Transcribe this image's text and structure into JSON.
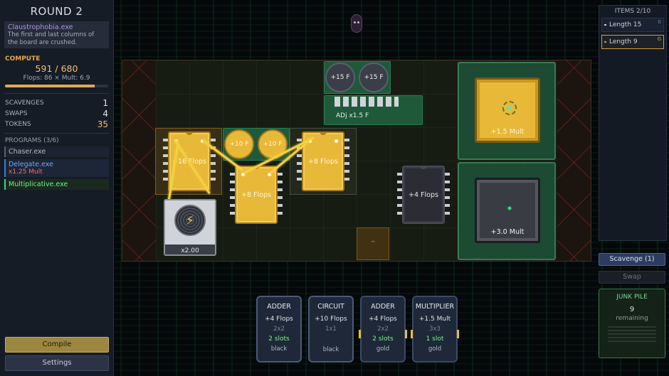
{
  "sidebar": {
    "round_title": "ROUND 2",
    "modifier": {
      "name": "Claustrophobia.exe",
      "description": "The first and last columns of the board are crushed."
    },
    "compute": {
      "label": "COMPUTE",
      "value": "591 / 680",
      "detail": "Flops: 86  ×  Mult: 6.9",
      "progress_fraction": 0.869
    },
    "stats": [
      {
        "label": "SCAVENGES",
        "value": "1"
      },
      {
        "label": "SWAPS",
        "value": "4"
      },
      {
        "label": "TOKENS",
        "value": "35"
      }
    ],
    "programs_header": "PROGRAMS (3/6)",
    "programs": [
      {
        "name": "Chaser.exe",
        "effect": ""
      },
      {
        "name": "Delegate.exe",
        "effect": "x1.25 Mult"
      },
      {
        "name": "Multiplicative.exe",
        "effect": ""
      }
    ],
    "compile_label": "Compile",
    "settings_label": "Settings"
  },
  "items_panel": {
    "header": "ITEMS 2/10",
    "items": [
      {
        "label": "Length 15",
        "key": "B"
      },
      {
        "label": "Length 9",
        "key": "G"
      }
    ],
    "scavenge_label": "Scavenge (1)",
    "swap_label": "Swap",
    "junk": {
      "title": "JUNK PILE",
      "count": "9",
      "sub": "remaining"
    }
  },
  "board": {
    "chips": [
      {
        "label": "+16 Flops",
        "color": "gold"
      },
      {
        "label": "+8 Flops",
        "color": "gold"
      },
      {
        "label": "+8 Flops",
        "color": "gold"
      },
      {
        "label": "+4 Flops",
        "color": "black"
      }
    ],
    "caps": [
      {
        "label": "+10 F"
      },
      {
        "label": "+10 F"
      },
      {
        "label": "+15 F"
      },
      {
        "label": "+15 F"
      }
    ],
    "adj_label": "ADj x1.5 F",
    "psu_label": "x2.00",
    "cpus": [
      {
        "label": "+1.5 Mult",
        "color": "gold"
      },
      {
        "label": "+3.0 Mult",
        "color": "dark"
      }
    ],
    "empty_slot_marker": "^"
  },
  "hand": [
    {
      "title": "ADDER",
      "effect": "+4 Flops",
      "size": "2x2",
      "slots": "2 slots",
      "type": "black"
    },
    {
      "title": "CIRCUIT",
      "effect": "+10 Flops",
      "size": "1x1",
      "slots": "",
      "type": "black"
    },
    {
      "title": "ADDER",
      "effect": "+4 Flops",
      "size": "2x2",
      "slots": "2 slots",
      "type": "gold"
    },
    {
      "title": "MULTIPLIER",
      "effect": "+1.5 Mult",
      "size": "3x3",
      "slots": "1 slot",
      "type": "gold"
    }
  ],
  "colors": {
    "accent": "#e8b838",
    "compute": "#f0c070",
    "delegate": "#6ca8ff",
    "multiplicative": "#6ef08c",
    "board_bg": "#161c12"
  }
}
